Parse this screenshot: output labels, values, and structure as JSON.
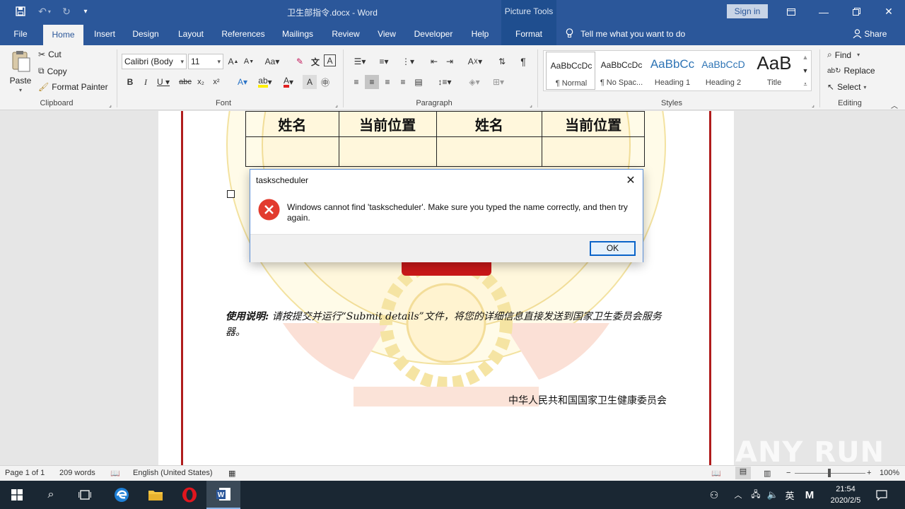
{
  "window": {
    "doc_title": "卫生部指令.docx  -  Word",
    "context_tab": "Picture Tools",
    "sign_in": "Sign in"
  },
  "tabs": [
    {
      "label": "File"
    },
    {
      "label": "Home"
    },
    {
      "label": "Insert"
    },
    {
      "label": "Design"
    },
    {
      "label": "Layout"
    },
    {
      "label": "References"
    },
    {
      "label": "Mailings"
    },
    {
      "label": "Review"
    },
    {
      "label": "View"
    },
    {
      "label": "Developer"
    },
    {
      "label": "Help"
    },
    {
      "label": "Format"
    }
  ],
  "tell_me": "Tell me what you want to do",
  "share": "Share",
  "clipboard": {
    "paste": "Paste",
    "cut": "Cut",
    "copy": "Copy",
    "format_painter": "Format Painter",
    "label": "Clipboard"
  },
  "font": {
    "name": "Calibri (Body",
    "size": "11",
    "label": "Font"
  },
  "paragraph": {
    "label": "Paragraph"
  },
  "styles": {
    "label": "Styles",
    "items": [
      {
        "sample": "AaBbCcDc",
        "name": "¶ Normal"
      },
      {
        "sample": "AaBbCcDc",
        "name": "¶ No Spac..."
      },
      {
        "sample": "AaBbCc",
        "name": "Heading 1"
      },
      {
        "sample": "AaBbCcD",
        "name": "Heading 2"
      },
      {
        "sample": "AaB",
        "name": "Title"
      }
    ]
  },
  "editing": {
    "find": "Find",
    "replace": "Replace",
    "select": "Select",
    "label": "Editing"
  },
  "document": {
    "table_headers": [
      "姓名",
      "当前位置",
      "姓名",
      "当前位置"
    ],
    "usage_label": "使用说明:",
    "usage_text": " 请按提交并运行“Submit details”文件，将您的详细信息直接发送到国家卫生委员会服务器。",
    "organization": "中华人民共和国国家卫生健康委员会",
    "watermark": "ANY RUN"
  },
  "dialog": {
    "title": "taskscheduler",
    "message": "Windows cannot find 'taskscheduler'. Make sure you typed the name correctly, and then try again.",
    "ok": "OK"
  },
  "status": {
    "page": "Page 1 of 1",
    "words": "209 words",
    "language": "English (United States)",
    "zoom": "100%"
  },
  "taskbar": {
    "ime": "英",
    "time": "21:54",
    "date": "2020/2/5"
  },
  "colors": {
    "word_blue": "#2b579a",
    "frame_red": "#b01d1d",
    "taskbar": "#1a2733"
  }
}
